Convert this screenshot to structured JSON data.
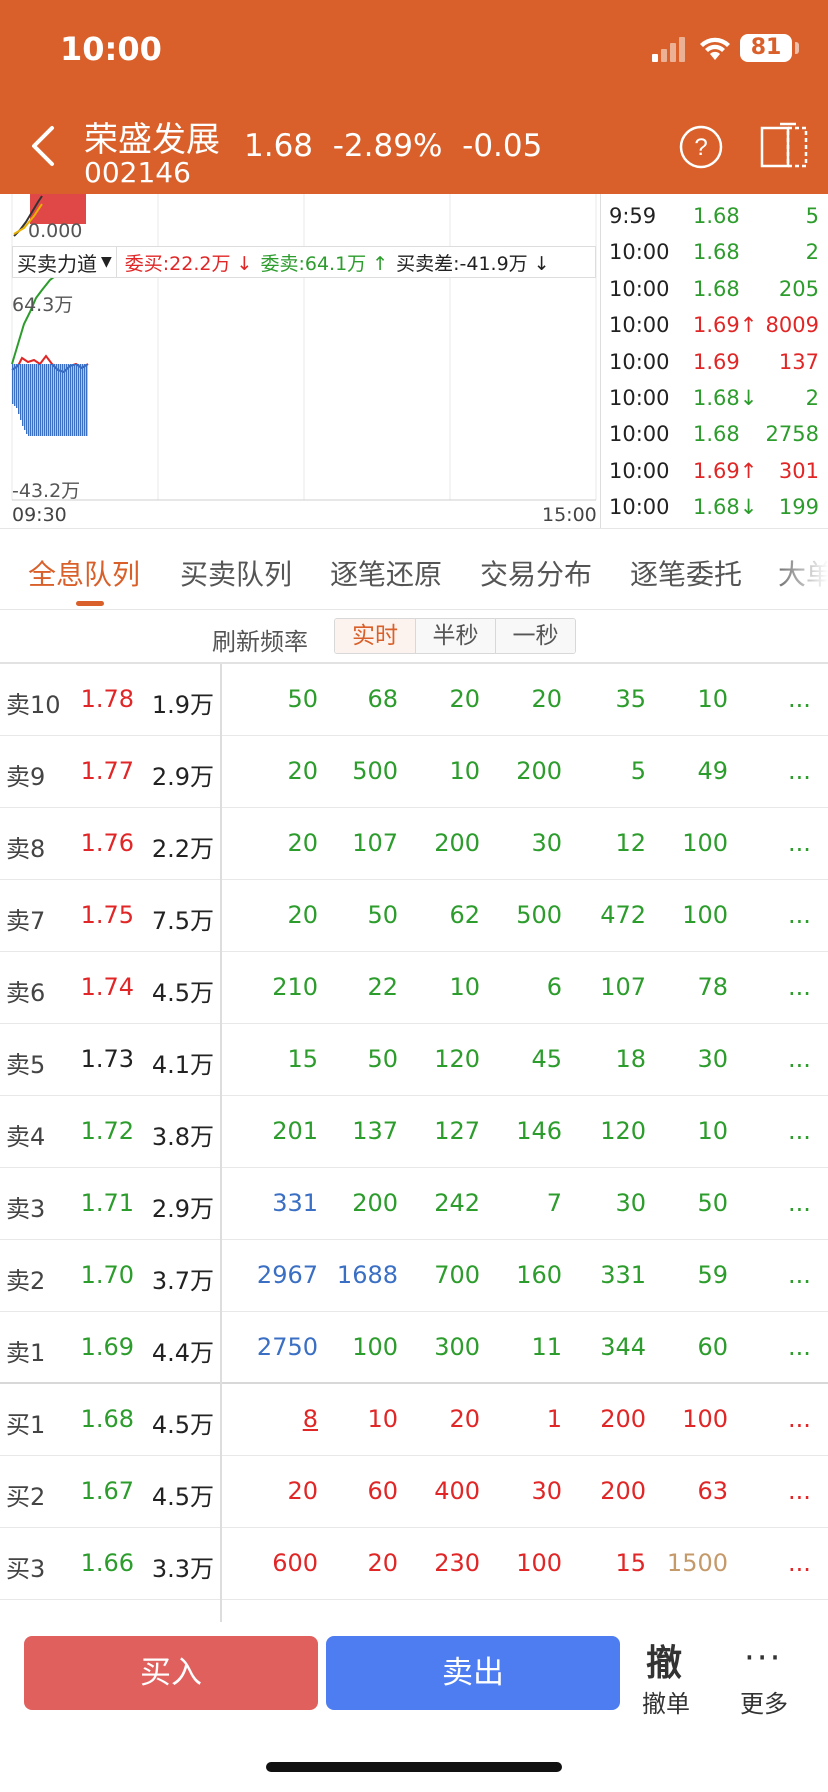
{
  "status_bar": {
    "time": "10:00",
    "battery": "81"
  },
  "header": {
    "stock_name": "荣盛发展",
    "stock_code": "002146",
    "price": "1.68",
    "change_pct": "-2.89%",
    "change": "-0.05"
  },
  "chart": {
    "top_label": "0.000",
    "indicator_select": "买卖力道",
    "buy_orders": "委买:22.2万 ↓",
    "sell_orders": "委卖:64.1万 ↑",
    "diff": "买卖差:-41.9万 ↓",
    "max_label": "64.3万",
    "min_label": "-43.2万",
    "time_start": "09:30",
    "time_end": "15:00"
  },
  "trades": [
    {
      "time": "9:59",
      "price": "1.68",
      "vol": "5",
      "dir": "down"
    },
    {
      "time": "10:00",
      "price": "1.68",
      "vol": "2",
      "dir": "down"
    },
    {
      "time": "10:00",
      "price": "1.68",
      "vol": "205",
      "dir": "down"
    },
    {
      "time": "10:00",
      "price": "1.69↑",
      "vol": "8009",
      "dir": "up"
    },
    {
      "time": "10:00",
      "price": "1.69",
      "vol": "137",
      "dir": "up"
    },
    {
      "time": "10:00",
      "price": "1.68↓",
      "vol": "2",
      "dir": "down"
    },
    {
      "time": "10:00",
      "price": "1.68",
      "vol": "2758",
      "dir": "down"
    },
    {
      "time": "10:00",
      "price": "1.69↑",
      "vol": "301",
      "dir": "up"
    },
    {
      "time": "10:00",
      "price": "1.68↓",
      "vol": "199",
      "dir": "down"
    }
  ],
  "tabs": [
    "全息队列",
    "买卖队列",
    "逐笔还原",
    "交易分布",
    "逐笔委托",
    "大单"
  ],
  "refresh": {
    "label": "刷新频率",
    "options": [
      "实时",
      "半秒",
      "一秒"
    ]
  },
  "queue": [
    {
      "label": "卖10",
      "price": "1.78",
      "price_dir": "up",
      "total": "1.9万",
      "orders": [
        "50",
        "68",
        "20",
        "20",
        "35",
        "10"
      ],
      "colors": [
        "down",
        "down",
        "down",
        "down",
        "down",
        "down"
      ]
    },
    {
      "label": "卖9",
      "price": "1.77",
      "price_dir": "up",
      "total": "2.9万",
      "orders": [
        "20",
        "500",
        "10",
        "200",
        "5",
        "49"
      ],
      "colors": [
        "down",
        "down",
        "down",
        "down",
        "down",
        "down"
      ]
    },
    {
      "label": "卖8",
      "price": "1.76",
      "price_dir": "up",
      "total": "2.2万",
      "orders": [
        "20",
        "107",
        "200",
        "30",
        "12",
        "100"
      ],
      "colors": [
        "down",
        "down",
        "down",
        "down",
        "down",
        "down"
      ]
    },
    {
      "label": "卖7",
      "price": "1.75",
      "price_dir": "up",
      "total": "7.5万",
      "orders": [
        "20",
        "50",
        "62",
        "500",
        "472",
        "100"
      ],
      "colors": [
        "down",
        "down",
        "down",
        "down",
        "down",
        "down"
      ]
    },
    {
      "label": "卖6",
      "price": "1.74",
      "price_dir": "up",
      "total": "4.5万",
      "orders": [
        "210",
        "22",
        "10",
        "6",
        "107",
        "78"
      ],
      "colors": [
        "down",
        "down",
        "down",
        "down",
        "down",
        "down"
      ]
    },
    {
      "label": "卖5",
      "price": "1.73",
      "price_dir": "neutral",
      "total": "4.1万",
      "orders": [
        "15",
        "50",
        "120",
        "45",
        "18",
        "30"
      ],
      "colors": [
        "down",
        "down",
        "down",
        "down",
        "down",
        "down"
      ]
    },
    {
      "label": "卖4",
      "price": "1.72",
      "price_dir": "down",
      "total": "3.8万",
      "orders": [
        "201",
        "137",
        "127",
        "146",
        "120",
        "10"
      ],
      "colors": [
        "down",
        "down",
        "down",
        "down",
        "down",
        "down"
      ]
    },
    {
      "label": "卖3",
      "price": "1.71",
      "price_dir": "down",
      "total": "2.9万",
      "orders": [
        "331",
        "200",
        "242",
        "7",
        "30",
        "50"
      ],
      "colors": [
        "big",
        "down",
        "down",
        "down",
        "down",
        "down"
      ]
    },
    {
      "label": "卖2",
      "price": "1.70",
      "price_dir": "down",
      "total": "3.7万",
      "orders": [
        "2967",
        "1688",
        "700",
        "160",
        "331",
        "59"
      ],
      "colors": [
        "big",
        "big",
        "down",
        "down",
        "down",
        "down"
      ]
    },
    {
      "label": "卖1",
      "price": "1.69",
      "price_dir": "down",
      "total": "4.4万",
      "orders": [
        "2750",
        "100",
        "300",
        "11",
        "344",
        "60"
      ],
      "colors": [
        "big",
        "down",
        "down",
        "down",
        "down",
        "down"
      ]
    },
    {
      "label": "买1",
      "price": "1.68",
      "price_dir": "down",
      "total": "4.5万",
      "orders": [
        "8",
        "10",
        "20",
        "1",
        "200",
        "100"
      ],
      "colors": [
        "up ul",
        "up",
        "up",
        "up",
        "up",
        "up"
      ]
    },
    {
      "label": "买2",
      "price": "1.67",
      "price_dir": "down",
      "total": "4.5万",
      "orders": [
        "20",
        "60",
        "400",
        "30",
        "200",
        "63"
      ],
      "colors": [
        "up",
        "up",
        "up",
        "up",
        "up",
        "up"
      ]
    },
    {
      "label": "买3",
      "price": "1.66",
      "price_dir": "down",
      "total": "3.3万",
      "orders": [
        "600",
        "20",
        "230",
        "100",
        "15",
        "1500"
      ],
      "colors": [
        "up",
        "up",
        "up",
        "up",
        "up",
        "gold"
      ]
    }
  ],
  "more_cell": "...",
  "bottom": {
    "buy": "买入",
    "sell": "卖出",
    "cancel_icon": "撤",
    "cancel": "撤单",
    "more_icon": "···",
    "more": "更多"
  },
  "colors": {
    "brand": "#d9602a",
    "up": "#e02626",
    "down": "#2c9c2c",
    "big_order": "#3a6fc4",
    "buy_button": "#e0605e",
    "sell_button": "#4d7df0"
  }
}
